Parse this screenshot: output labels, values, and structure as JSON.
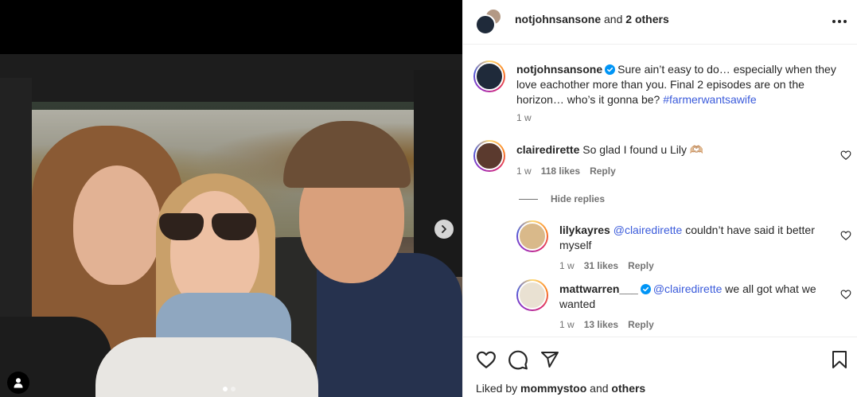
{
  "header": {
    "username": "notjohnsansone",
    "connector": "and",
    "others": "2 others"
  },
  "caption": {
    "username": "notjohnsansone",
    "text": "Sure ain’t easy to do… especially when they love eachother more than you. Final 2 episodes are on the horizon… who’s it gonna be?",
    "hashtag": "#farmerwantsawife",
    "time": "1 w"
  },
  "comments": [
    {
      "username": "clairedirette",
      "text": "So glad I found u Lily 🫶🏼",
      "time": "1 w",
      "likes": "118 likes",
      "reply": "Reply"
    }
  ],
  "hide_replies": "Hide replies",
  "replies": [
    {
      "username": "lilykayres",
      "mention": "@clairedirette",
      "text": "couldn’t have said it better myself",
      "time": "1 w",
      "likes": "31 likes",
      "reply": "Reply"
    },
    {
      "username": "mattwarren___",
      "mention": "@clairedirette",
      "text": "we all got what we wanted",
      "time": "1 w",
      "likes": "13 likes",
      "reply": "Reply"
    }
  ],
  "liked_by": {
    "prefix": "Liked by",
    "user": "mommystoo",
    "connector": "and",
    "others": "others"
  },
  "icons": {
    "verified": "verified-badge-icon",
    "more": "more-horizontal-icon",
    "like": "heart-icon",
    "comment": "comment-icon",
    "share": "send-icon",
    "save": "bookmark-icon",
    "next": "chevron-right-icon",
    "tag": "user-tag-icon"
  },
  "colors": {
    "accent": "#0095f6",
    "link": "#3b5bdb",
    "muted": "#737373"
  },
  "carousel": {
    "slide_count": 2,
    "active_index": 0
  }
}
